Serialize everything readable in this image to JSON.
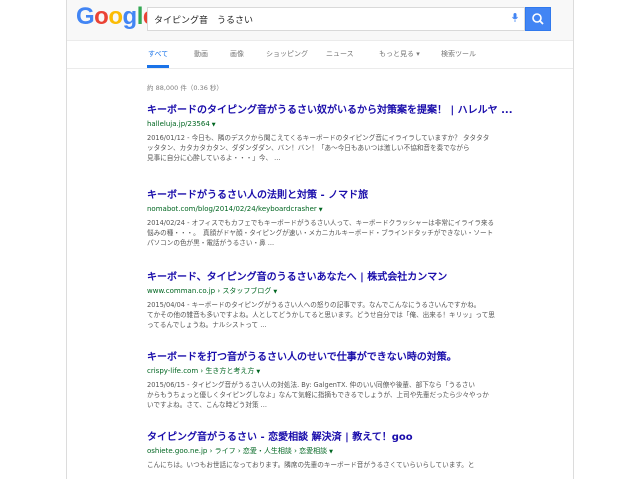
{
  "logo": {
    "letters": [
      "G",
      "o",
      "o",
      "g",
      "l",
      "e"
    ]
  },
  "search": {
    "query": "タイピング音　うるさい"
  },
  "tabs": [
    {
      "label": "すべて"
    },
    {
      "label": "動画"
    },
    {
      "label": "画像"
    },
    {
      "label": "ショッピング"
    },
    {
      "label": "ニュース"
    },
    {
      "label": "もっと見る ▾"
    },
    {
      "label": "検索ツール"
    }
  ],
  "stats": "約 88,000 件（0.36 秒）",
  "results": [
    {
      "title": "キーボードのタイピング音がうるさい奴がいるから対策案を提案！ | ハレルヤ ...",
      "url": "halleluja.jp/23564",
      "snippet": [
        "2016/01/12 - 今日も、隣のデスクから聞こえてくるキーボードのタイピング音にイライラしていますか？ タタタタ",
        "ッタタン、カタカタカタン、ダダンダダン、バン！バン！「あ～今日もあいつは激しい不協和音を奏でながら",
        "見事に自分に心酔しているよ・・・」今、 ..."
      ]
    },
    {
      "title": "キーボードがうるさい人の法則と対策 - ノマド旅",
      "url": "nomabot.com/blog/2014/02/24/keyboardcrasher",
      "snippet": [
        "2014/02/24 - オフィスでもカフェでもキーボードがうるさい人って、キーボードクラッシャーは非常にイライラ来る",
        "悩みの種・・・。　真顔がドヤ顔・タイピングが速い・メカニカルキーボード・ブラインドタッチができない・ソート",
        "パソコンの色が黒・電話がうるさい・鼻 ..."
      ]
    },
    {
      "title": "キーボード、タイピング音のうるさいあなたへ | 株式会社カンマン",
      "url": "www.comman.co.jp › スタッフブログ",
      "snippet": [
        "2015/04/04 - キーボードのタイピングがうるさい人への怒りの記事です。なんでこんなにうるさいんですかね。",
        "てかその他の雑音も多いですよね。人としてどうかしてると思います。どうせ自分では「俺、出来る！キリッ」って思",
        "ってるんでしょうね。ナルシストって ..."
      ]
    },
    {
      "title": "キーボードを打つ音がうるさい人のせいで仕事ができない時の対策。",
      "url": "crispy-life.com › 生き方と考え方",
      "snippet": [
        "2015/06/15 - タイピング音がうるさい人の対処法. By: GalgenTX. 仲のいい同僚や後輩、部下なら「うるさい",
        "からもうちょっと優しくタイピングしなよ」なんて気軽に指摘もできるでしょうが、上司や先輩だったら少々やっか",
        "いですよね。さて、こんな時どう対策 ..."
      ]
    },
    {
      "title": "タイピング音がうるさい - 恋愛相談 解決済 | 教えて！goo",
      "url": "oshiete.goo.ne.jp › ライフ › 恋愛・人生相談 › 恋愛相談",
      "snippet": [
        "こんにちは。いつもお世話になっております。隣席の先輩のキーボード音がうるさくていらいらしています。と"
      ]
    }
  ]
}
